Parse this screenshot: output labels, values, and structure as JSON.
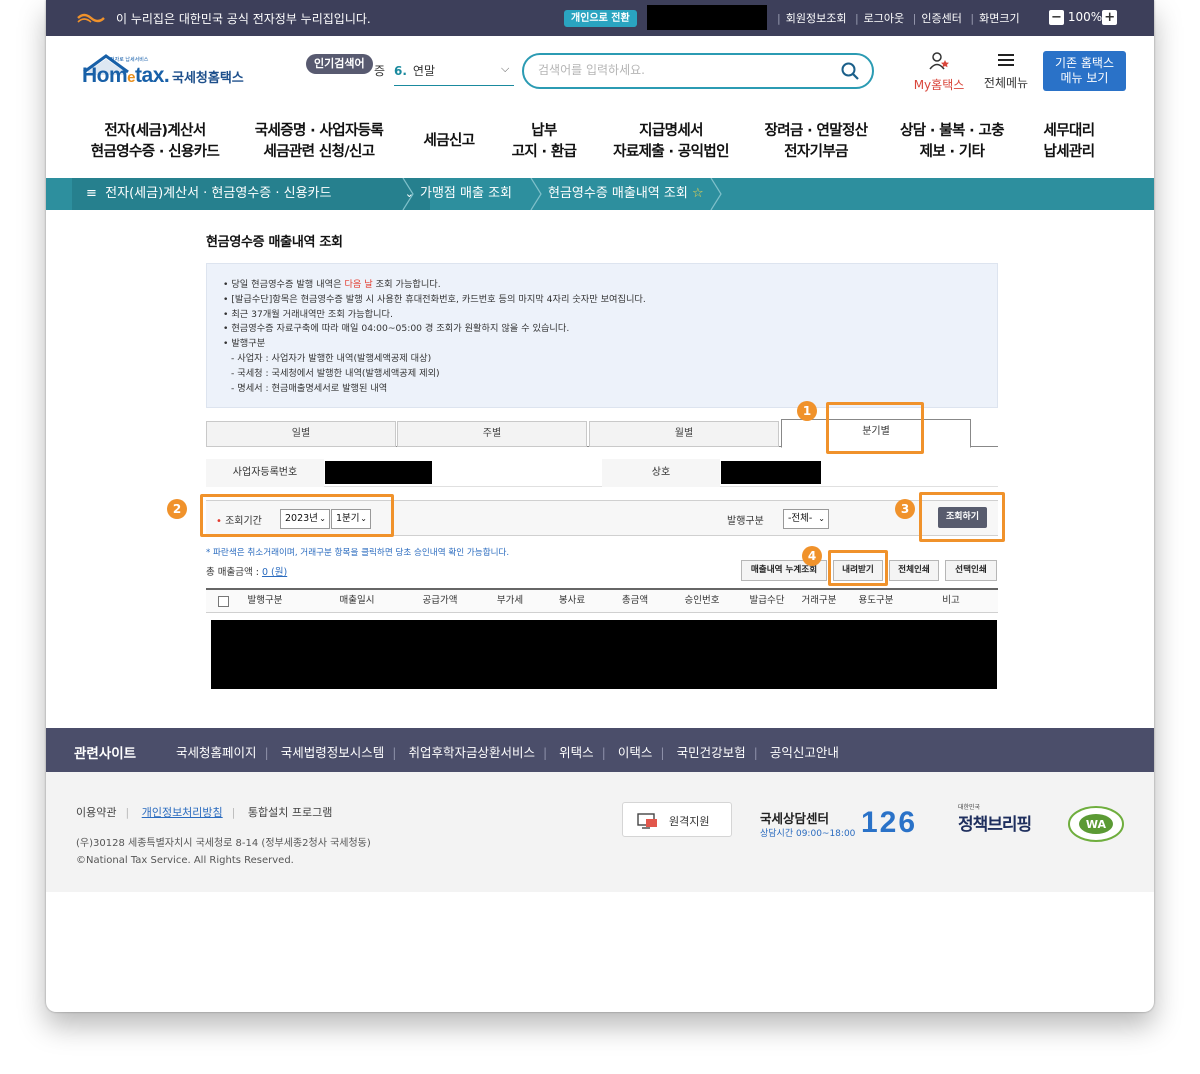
{
  "gov_banner": {
    "notice": "이 누리집은 대한민국 공식 전자정부 누리집입니다.",
    "toggle": "개인으로 전환",
    "links": [
      "회원정보조회",
      "로그아웃",
      "인증센터",
      "화면크기"
    ],
    "zoom": "100%"
  },
  "header": {
    "logo_text": "Hometax.",
    "logo_kr": "국세청홈택스",
    "logo_small": "전자로 납세서비스",
    "popular_tag": "인기검색어",
    "popular_rank": "증",
    "popular_num": "6.",
    "popular_word": "연말",
    "search_placeholder": "검색어를 입력하세요.",
    "my_label": "My홈택스",
    "menu_label": "전체메뉴",
    "legacy_line1": "기존 홈택스",
    "legacy_line2": "메뉴 보기"
  },
  "gnb": [
    "전자(세금)계산서\n현금영수증 · 신용카드",
    "국세증명 · 사업자등록\n세금관련 신청/신고",
    "세금신고",
    "납부\n고지 · 환급",
    "지급명세서\n자료제출 · 공익법인",
    "장려금 · 연말정산\n전자기부금",
    "상담 · 불복 · 고충\n제보 · 기타",
    "세무대리\n납세관리"
  ],
  "breadcrumb": {
    "menu": "전자(세금)계산서 · 현금영수증 · 신용카드",
    "level2": "가맹점 매출 조회",
    "level3": "현금영수증 매출내역 조회"
  },
  "page_title": "현금영수증 매출내역 조회",
  "info": {
    "l1a": "당일 현금영수증 발행 내역은 ",
    "l1b": "다음 날",
    "l1c": " 조회 가능합니다.",
    "l2": "[발급수단]항목은 현금영수증 발행 시 사용한 휴대전화번호, 카드번호 등의 마지막 4자리 숫자만 보여집니다.",
    "l3": "최근 37개월 거래내역만 조회 가능합니다.",
    "l4": "현금영수증 자료구축에 따라 매일 04:00~05:00 경 조회가 원활하지 않을 수 있습니다.",
    "l5": "발행구분",
    "s1": "- 사업자 : 사업자가 발행한 내역(발행세액공제 대상)",
    "s2": "- 국세청 : 국세청에서 발행한 내역(발행세액공제 제외)",
    "s3": "- 명세서 : 현금매출명세서로 발행된 내역"
  },
  "tabs": [
    "일별",
    "주별",
    "월별",
    "분기별"
  ],
  "biz": {
    "reg_label": "사업자등록번호",
    "name_label": "상호"
  },
  "query": {
    "period_label": "조회기간",
    "year": "2023년",
    "quarter": "1분기",
    "type_label": "발행구분",
    "type_value": "-전체-",
    "button": "조회하기"
  },
  "note": "* 파란색은 취소거래이며, 거래구분 항목을 클릭하면 당초 승인내역 확인 가능합니다.",
  "total": {
    "label": "총 매출금액 : ",
    "value": "0 (원)"
  },
  "actions": [
    "매출내역 누계조회",
    "내려받기",
    "전체인쇄",
    "선택인쇄"
  ],
  "columns": [
    "발행구분",
    "매출일시",
    "공급가액",
    "부가세",
    "봉사료",
    "총금액",
    "승인번호",
    "발급수단",
    "거래구분",
    "용도구분",
    "비고"
  ],
  "badges": [
    "1",
    "2",
    "3",
    "4"
  ],
  "related": {
    "title": "관련사이트",
    "sites": [
      "국세청홈페이지",
      "국세법령정보시스템",
      "취업후학자금상환서비스",
      "위택스",
      "이택스",
      "국민건강보험",
      "공익신고안내"
    ]
  },
  "footer": {
    "terms": "이용약관",
    "privacy": "개인정보처리방침",
    "install": "통합설치 프로그램",
    "address": "(우)30128 세종특별자치시 국세청로 8-14 (정부세종2청사 국세청동)",
    "copyright": "©National Tax Service. All Rights Reserved.",
    "remote": "원격지원",
    "center_title": "국세상담센터",
    "center_hours": "상담시간 09:00~18:00",
    "center_number": "126",
    "brief_small": "대한민국",
    "brief": "정책브리핑",
    "was": "WA"
  },
  "colors": {
    "accent": "#2d8f9e",
    "highlight": "#f0922b",
    "banner": "#3d3f5a",
    "brand": "#1860a8"
  }
}
